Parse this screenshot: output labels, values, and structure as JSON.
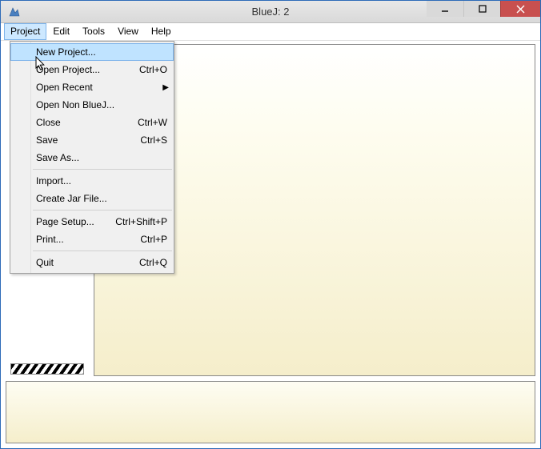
{
  "title": "BlueJ:  2",
  "menubar": [
    "Project",
    "Edit",
    "Tools",
    "View",
    "Help"
  ],
  "menubar_active_index": 0,
  "dropdown": {
    "groups": [
      [
        {
          "label": "New Project...",
          "accel": "",
          "submenu": false,
          "highlight": true
        },
        {
          "label": "Open Project...",
          "accel": "Ctrl+O",
          "submenu": false,
          "highlight": false
        },
        {
          "label": "Open Recent",
          "accel": "",
          "submenu": true,
          "highlight": false
        },
        {
          "label": "Open Non BlueJ...",
          "accel": "",
          "submenu": false,
          "highlight": false
        },
        {
          "label": "Close",
          "accel": "Ctrl+W",
          "submenu": false,
          "highlight": false
        },
        {
          "label": "Save",
          "accel": "Ctrl+S",
          "submenu": false,
          "highlight": false
        },
        {
          "label": "Save As...",
          "accel": "",
          "submenu": false,
          "highlight": false
        }
      ],
      [
        {
          "label": "Import...",
          "accel": "",
          "submenu": false,
          "highlight": false
        },
        {
          "label": "Create Jar File...",
          "accel": "",
          "submenu": false,
          "highlight": false
        }
      ],
      [
        {
          "label": "Page Setup...",
          "accel": "Ctrl+Shift+P",
          "submenu": false,
          "highlight": false
        },
        {
          "label": "Print...",
          "accel": "Ctrl+P",
          "submenu": false,
          "highlight": false
        }
      ],
      [
        {
          "label": "Quit",
          "accel": "Ctrl+Q",
          "submenu": false,
          "highlight": false
        }
      ]
    ]
  }
}
